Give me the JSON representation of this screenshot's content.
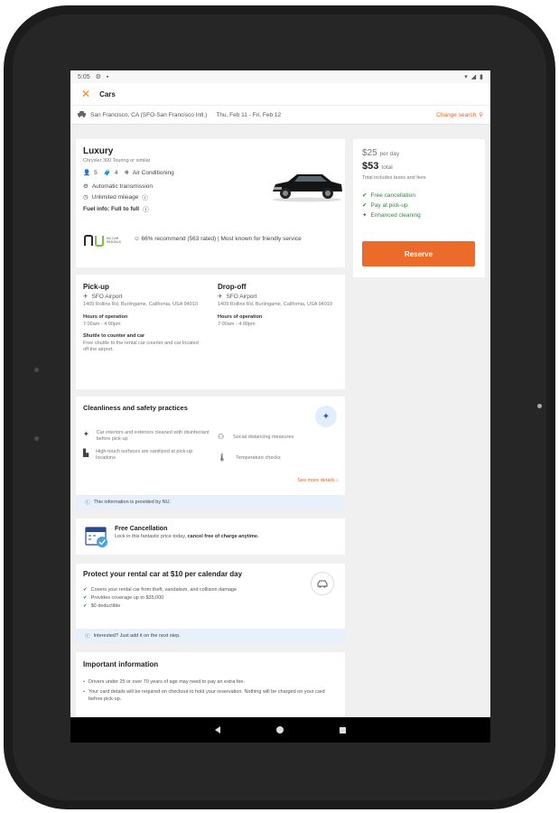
{
  "status": {
    "time": "5:05",
    "icons": [
      "gear-icon",
      "sd-card-icon",
      "wifi-icon",
      "signal-icon",
      "battery-icon"
    ]
  },
  "appbar": {
    "title": "Cars"
  },
  "search": {
    "location": "San Francisco, CA (SFO-San Francisco Intl.)",
    "dates": "Thu, Feb 11 - Fri, Feb 12",
    "change_label": "Change search"
  },
  "car": {
    "category": "Luxury",
    "model": "Chrysler 300 Touring or similar",
    "seats": "5",
    "bags": "4",
    "ac": "Air Conditioning",
    "transmission": "Automatic transmission",
    "mileage": "Unlimited mileage",
    "fuel": "Fuel info: Full to full",
    "vendor_logo": "NU CAR RENTALS",
    "rating_text": "66% recommend (563 rated) | Most known for friendly service",
    "rating_pct": "66%"
  },
  "price": {
    "per_day": "$25",
    "per_day_unit": "per day",
    "total": "$53",
    "total_unit": "total",
    "note": "Total includes taxes and fees",
    "features": [
      "Free cancellation",
      "Pay at pick-up",
      "Enhanced cleaning"
    ],
    "reserve_label": "Reserve"
  },
  "pickup": {
    "heading": "Pick-up",
    "location": "SFO Airport",
    "address": "1409 Rollins Rd, Burlingame, California, USA 94010",
    "hours_label": "Hours of operation",
    "hours": "7:00am - 4:00pm",
    "shuttle_label": "Shuttle to counter and car",
    "shuttle_text": "Free shuttle to the rental car counter and car located off the airport."
  },
  "dropoff": {
    "heading": "Drop-off",
    "location": "SFO Airport",
    "address": "1409 Rollins Rd, Burlingame, California, USA 94010",
    "hours_label": "Hours of operation",
    "hours": "7:00am - 4:00pm"
  },
  "cleanliness": {
    "heading": "Cleanliness and safety practices",
    "items": [
      "Car interiors and exteriors cleaned with disinfectant before pick-up",
      "High-touch surfaces are sanitized at pick-up locations",
      "Social distancing measures",
      "Temperature checks"
    ],
    "see_more": "See more details",
    "provided_by": "This information is provided by NU."
  },
  "cancellation": {
    "heading": "Free Cancellation",
    "text_prefix": "Lock in this fantastic price today,",
    "text_bold": "cancel free of charge anytime."
  },
  "protect": {
    "heading": "Protect your rental car at $10 per calendar day",
    "items": [
      "Covers your rental car from theft, vandalism, and collision damage",
      "Provides coverage up to $35,000",
      "$0 deductible"
    ],
    "info": "Interested? Just add it on the next step."
  },
  "important": {
    "heading": "Important information",
    "items": [
      "Drivers under 25 or over 70 years of age may need to pay an extra fee.",
      "Your card details will be required on checkout to hold your reservation. Nothing will be charged on your card before pick-up."
    ]
  },
  "colors": {
    "accent": "#ec6a2a",
    "check": "#2e8b3a",
    "info_bg": "#e8f1fb"
  }
}
